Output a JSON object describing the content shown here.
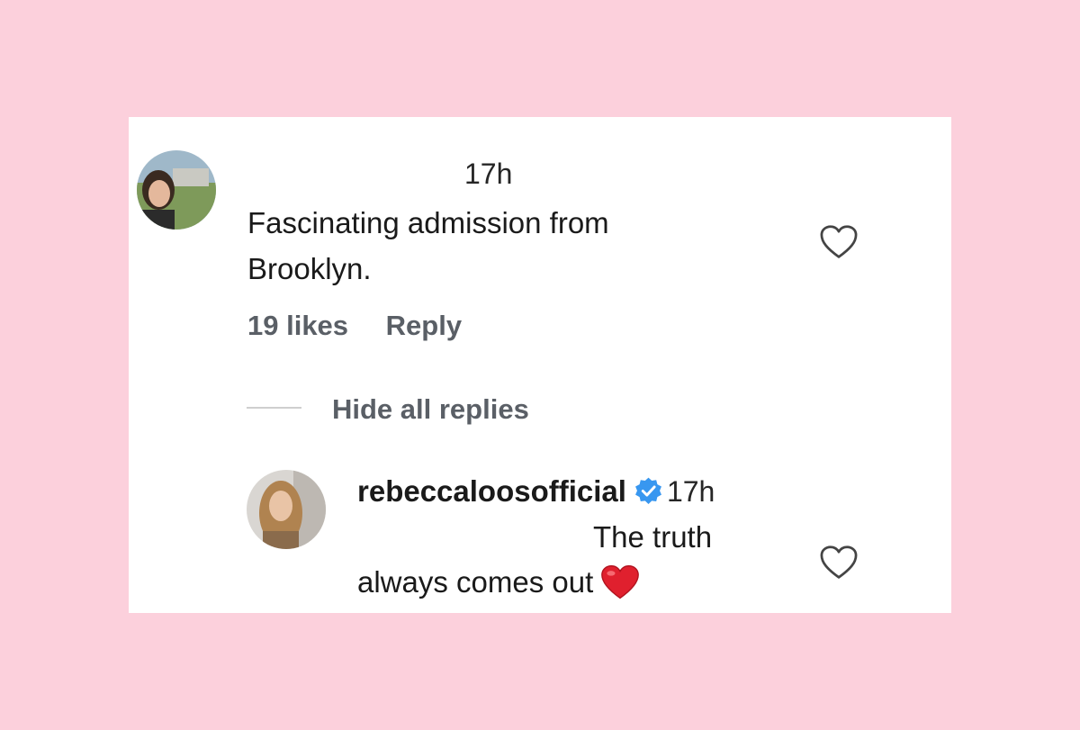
{
  "comments": [
    {
      "username": "",
      "timestamp": "17h",
      "text_lines": [
        "Fascinating admission from",
        "Brooklyn."
      ],
      "likes_label": "19 likes",
      "reply_label": "Reply"
    }
  ],
  "replies_toggle": {
    "label": "Hide all replies"
  },
  "reply": {
    "username": "rebeccaloosofficial",
    "verified": true,
    "timestamp": "17h",
    "text_line1": "The truth",
    "text_line2": "always comes out",
    "emoji": "red-heart-emoji"
  },
  "icons": {
    "like": "heart-outline-icon",
    "verified": "verified-badge-icon"
  },
  "colors": {
    "background": "#fcd0dc",
    "card": "#ffffff",
    "verified_blue": "#3897f0",
    "emoji_red": "#e0202e",
    "muted_text": "#5a5f66"
  }
}
